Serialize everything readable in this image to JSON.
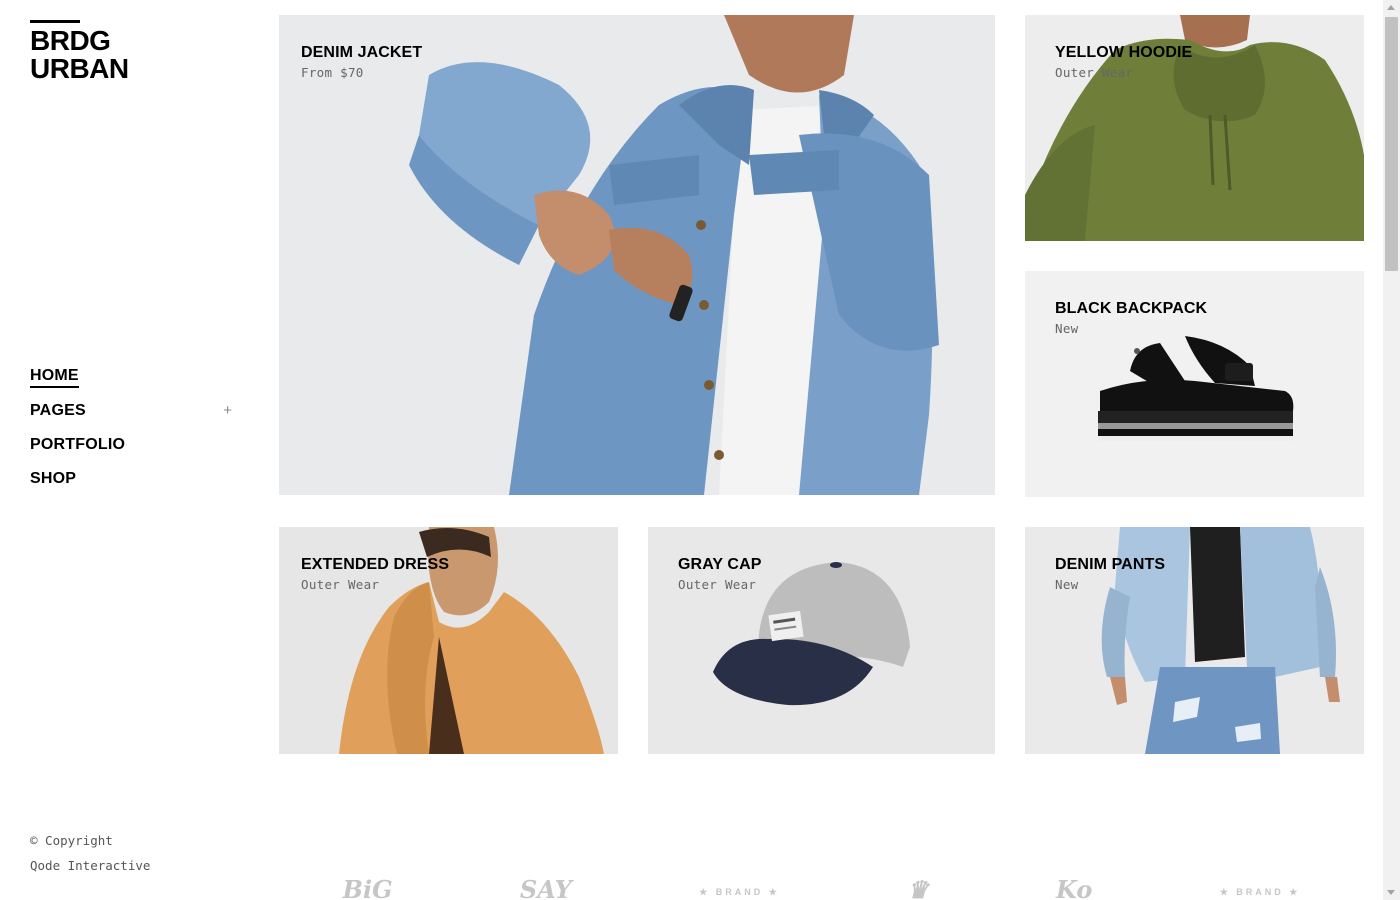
{
  "logo": {
    "line1": "BRDG",
    "line2": "URBAN"
  },
  "nav": {
    "items": [
      {
        "label": "HOME"
      },
      {
        "label": "PAGES",
        "expand_symbol": "+"
      },
      {
        "label": "PORTFOLIO"
      },
      {
        "label": "SHOP"
      }
    ]
  },
  "footer": {
    "copyright_line1": "© Copyright",
    "copyright_line2": "Qode Interactive"
  },
  "products": [
    {
      "title": "DENIM JACKET",
      "subtitle": "From $70"
    },
    {
      "title": "YELLOW HOODIE",
      "subtitle": "Outer Wear"
    },
    {
      "title": "BLACK BACKPACK",
      "subtitle": "New"
    },
    {
      "title": "EXTENDED DRESS",
      "subtitle": "Outer Wear"
    },
    {
      "title": "GRAY CAP",
      "subtitle": "Outer Wear"
    },
    {
      "title": "DENIM PANTS",
      "subtitle": "New"
    }
  ],
  "brands": [
    {
      "icon": "big-brand-logo",
      "text": "BiG"
    },
    {
      "icon": "say-brand-logo",
      "text": "SAY"
    },
    {
      "icon": "brand-badge-logo",
      "text": "★ BRAND ★"
    },
    {
      "icon": "crown-brand-logo",
      "text": "♛"
    },
    {
      "icon": "script-brand-logo",
      "text": "Ko"
    },
    {
      "icon": "brand-badge-logo-2",
      "text": "★ BRAND ★"
    }
  ],
  "colors": {
    "text": "#000000",
    "muted": "#666666",
    "tile_bg": "#ececec",
    "brand_grey": "#c6c6c6"
  }
}
